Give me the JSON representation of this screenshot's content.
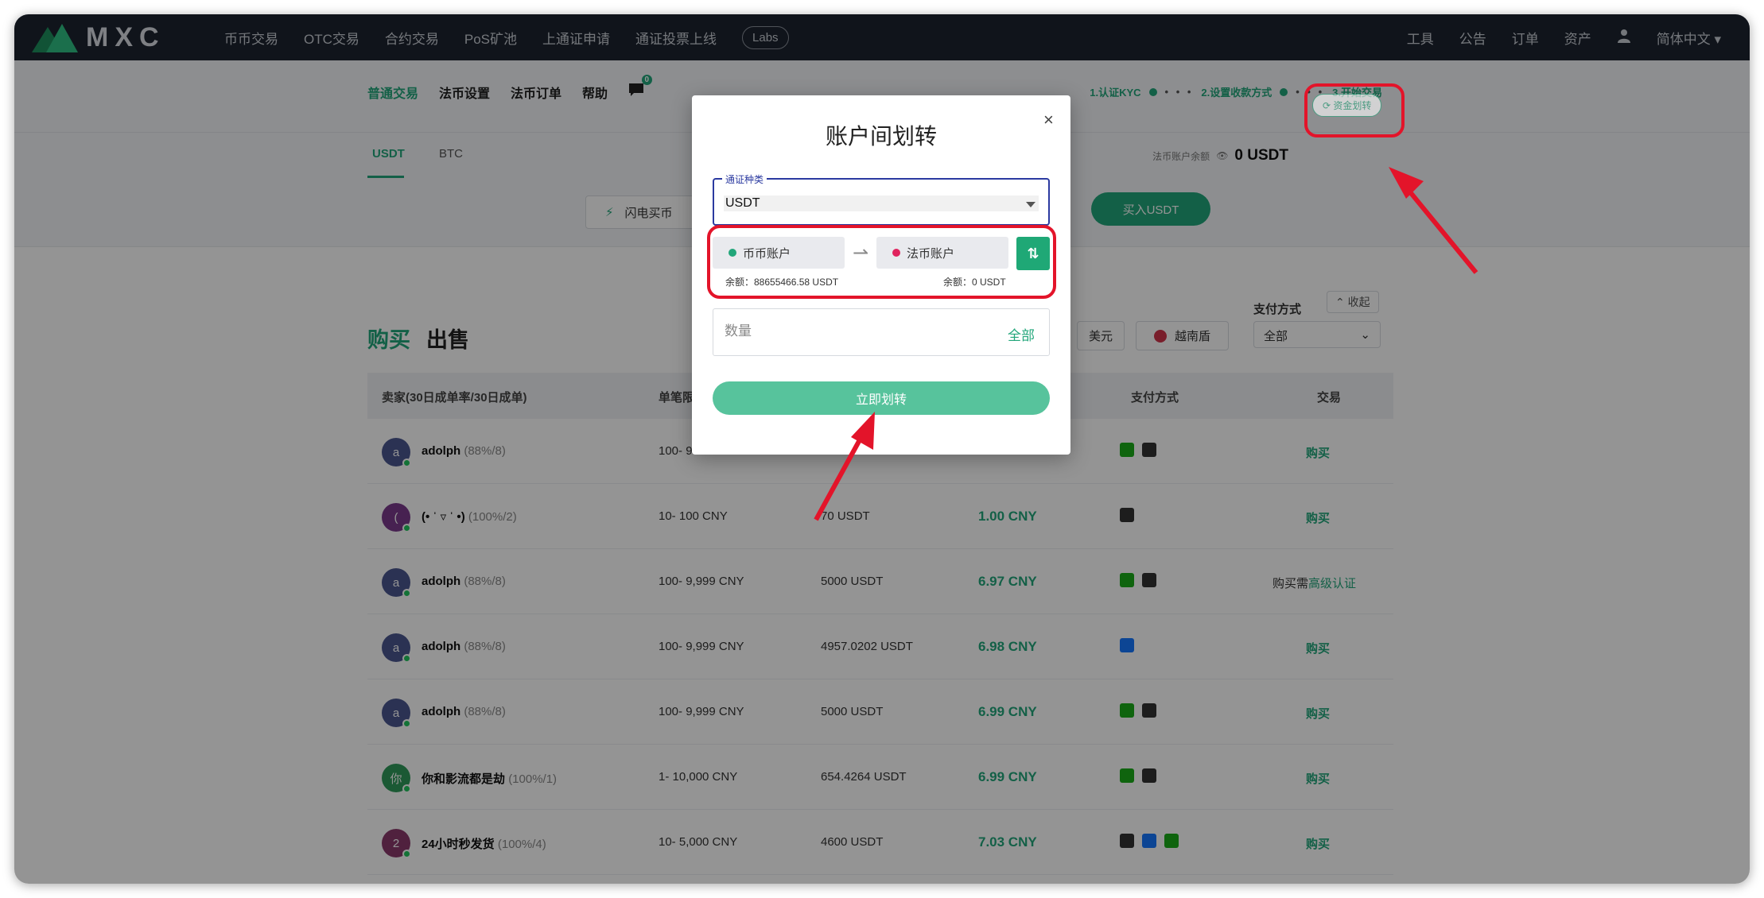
{
  "brand": {
    "name": "MXC",
    "color": "#22a67a"
  },
  "topnav": {
    "left_items": [
      "币币交易",
      "OTC交易",
      "合约交易",
      "PoS矿池",
      "上通证申请",
      "通证投票上线"
    ],
    "labs": "Labs",
    "right_items": [
      "工具",
      "公告",
      "订单",
      "资产"
    ],
    "language": "简体中文"
  },
  "subnav": {
    "links": [
      "普通交易",
      "法币设置",
      "法币订单",
      "帮助"
    ],
    "chat_badge": "0",
    "steps": [
      "1.认证KYC",
      "2.设置收款方式",
      "3.开始交易"
    ],
    "step_dots": "• • •"
  },
  "coins": {
    "tabs": [
      "USDT",
      "BTC"
    ],
    "active": "USDT"
  },
  "fiat": {
    "label": "法币账户余额",
    "balance": "0 USDT",
    "transfer_label": "资金划转"
  },
  "quick": {
    "flash_label": "闪电买币",
    "buy_label": "买入USDT",
    "collapse_label": "收起"
  },
  "market": {
    "buy_tab": "购买",
    "sell_tab": "出售",
    "filter_usd": "美元",
    "filter_vnd": "越南盾",
    "payment_label": "支付方式",
    "payment_selected": "全部"
  },
  "table": {
    "headers": [
      "卖家(30日成单率/30日成单)",
      "单笔限额",
      "支付方式",
      "交易"
    ],
    "rows": [
      {
        "initial": "a",
        "name": "adolph",
        "rate": "(88%/8)",
        "limit": "100- 9",
        "qty": "",
        "price": "",
        "pay": [
          "wechat",
          "card"
        ],
        "action": "购买",
        "avatar_color": "#4a5690"
      },
      {
        "initial": "(",
        "name": "(• ˈ ▿ ˈ •)",
        "rate": "(100%/2)",
        "limit": "10- 100 CNY",
        "qty": "70 USDT",
        "price": "1.00 CNY",
        "pay": [
          "card"
        ],
        "action": "购买",
        "avatar_color": "#7a3a8c"
      },
      {
        "initial": "a",
        "name": "adolph",
        "rate": "(88%/8)",
        "limit": "100- 9,999 CNY",
        "qty": "5000 USDT",
        "price": "6.97 CNY",
        "pay": [
          "wechat",
          "card"
        ],
        "action": "",
        "kyc_prefix": "购买需",
        "kyc_link": "高级认证",
        "avatar_color": "#4a5690"
      },
      {
        "initial": "a",
        "name": "adolph",
        "rate": "(88%/8)",
        "limit": "100- 9,999 CNY",
        "qty": "4957.0202 USDT",
        "price": "6.98 CNY",
        "pay": [
          "alipay"
        ],
        "action": "购买",
        "avatar_color": "#4a5690"
      },
      {
        "initial": "a",
        "name": "adolph",
        "rate": "(88%/8)",
        "limit": "100- 9,999 CNY",
        "qty": "5000 USDT",
        "price": "6.99 CNY",
        "pay": [
          "wechat",
          "card"
        ],
        "action": "购买",
        "avatar_color": "#4a5690"
      },
      {
        "initial": "你",
        "name": "你和影流都是劫",
        "rate": "(100%/1)",
        "limit": "1- 10,000 CNY",
        "qty": "654.4264 USDT",
        "price": "6.99 CNY",
        "pay": [
          "wechat",
          "card"
        ],
        "action": "购买",
        "avatar_color": "#2f9a5a"
      },
      {
        "initial": "2",
        "name": "24小时秒发货",
        "rate": "(100%/4)",
        "limit": "10- 5,000 CNY",
        "qty": "4600 USDT",
        "price": "7.03 CNY",
        "pay": [
          "card",
          "alipay",
          "wechat"
        ],
        "action": "购买",
        "avatar_color": "#8a3a6c"
      }
    ]
  },
  "modal": {
    "title": "账户间划转",
    "close": "×",
    "field_label": "通证种类",
    "selected_coin": "USDT",
    "from_account": "币币账户",
    "to_account": "法币账户",
    "from_balance": "余额：88655466.58 USDT",
    "to_balance": "余额：0 USDT",
    "qty_placeholder": "数量",
    "all_label": "全部",
    "submit_label": "立即划转",
    "from_color": "#22a67a",
    "to_color": "#e0245e"
  },
  "annotation_color": "#e3142a"
}
